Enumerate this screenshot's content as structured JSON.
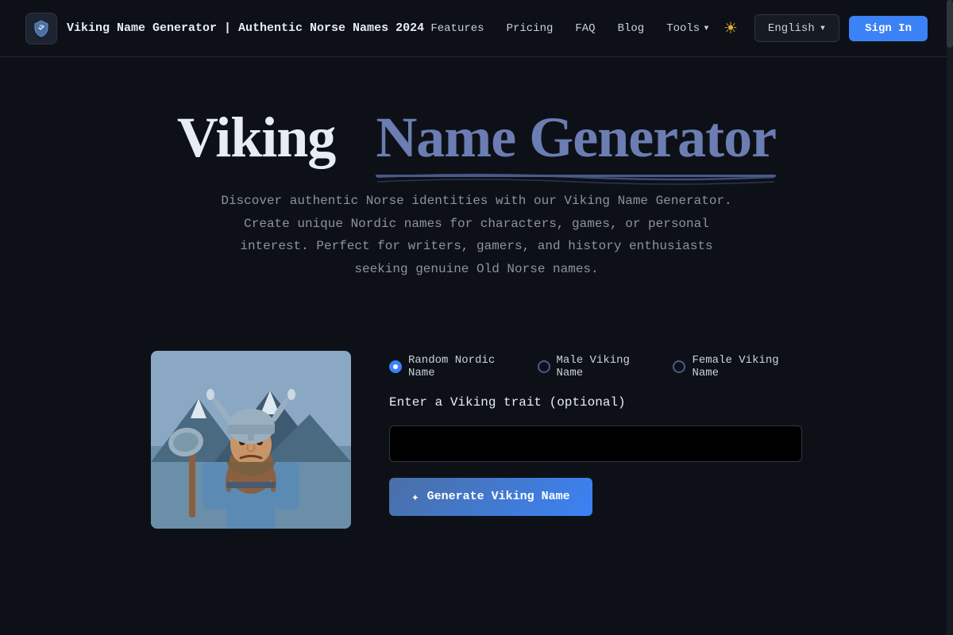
{
  "navbar": {
    "logo_alt": "Viking shield icon",
    "title": "Viking Name Generator | Authentic Norse Names 2024",
    "links": [
      {
        "label": "Features",
        "id": "features"
      },
      {
        "label": "Pricing",
        "id": "pricing"
      },
      {
        "label": "FAQ",
        "id": "faq"
      },
      {
        "label": "Blog",
        "id": "blog"
      },
      {
        "label": "Tools",
        "id": "tools"
      }
    ],
    "theme_icon": "☀",
    "language": "English",
    "language_chevron": "▾",
    "signin_label": "Sign In"
  },
  "hero": {
    "title_white": "Viking",
    "title_accent": "Name Generator",
    "description": "Discover authentic Norse identities with our Viking Name Generator. Create unique Nordic names for characters, games, or personal interest. Perfect for writers, gamers, and history enthusiasts seeking genuine Old Norse names."
  },
  "generator": {
    "radio_options": [
      {
        "label": "Random Nordic Name",
        "active": true
      },
      {
        "label": "Male Viking Name",
        "active": false
      },
      {
        "label": "Female Viking Name",
        "active": false
      }
    ],
    "input_label": "Enter a Viking trait (optional)",
    "input_placeholder": "",
    "generate_button": "Generate Viking Name",
    "wand_icon": "✦"
  }
}
